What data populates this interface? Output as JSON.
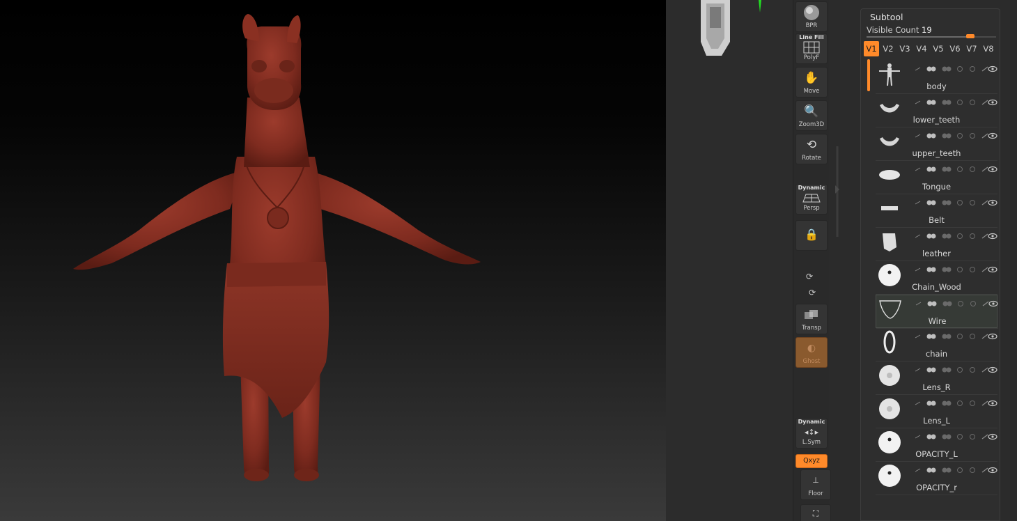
{
  "subtool": {
    "title": "Subtool",
    "visible_count_label": "Visible Count",
    "visible_count": "19",
    "visible_count_fraction": 0.8,
    "version_tabs": [
      "V1",
      "V2",
      "V3",
      "V4",
      "V5",
      "V6",
      "V7",
      "V8"
    ],
    "active_tab": "V1",
    "items": [
      {
        "name": "body",
        "icon": "body-thumb-icon"
      },
      {
        "name": "lower_teeth",
        "icon": "teeth-thumb-icon"
      },
      {
        "name": "upper_teeth",
        "icon": "teeth-thumb-icon"
      },
      {
        "name": "Tongue",
        "icon": "tongue-thumb-icon"
      },
      {
        "name": "Belt",
        "icon": "belt-thumb-icon"
      },
      {
        "name": "leather",
        "icon": "leather-thumb-icon"
      },
      {
        "name": "Chain_Wood",
        "icon": "sphere-thumb-icon"
      },
      {
        "name": "Wire",
        "icon": "wire-thumb-icon",
        "selected": true
      },
      {
        "name": "chain",
        "icon": "chain-link-thumb-icon"
      },
      {
        "name": "Lens_R",
        "icon": "lens-thumb-icon"
      },
      {
        "name": "Lens_L",
        "icon": "lens-thumb-icon"
      },
      {
        "name": "OPACITY_L",
        "icon": "sphere-thumb-icon"
      },
      {
        "name": "OPACITY_r",
        "icon": "sphere-thumb-icon"
      }
    ]
  },
  "shelf": {
    "bpr": "BPR",
    "linefill_top": "Line Fill",
    "polyf": "PolyF",
    "move": "Move",
    "zoom3d": "Zoom3D",
    "rotate": "Rotate",
    "dynamic_top": "Dynamic",
    "persp": "Persp",
    "transp": "Transp",
    "ghost": "Ghost",
    "lsym_top": "Dynamic",
    "lsym": "L.Sym",
    "xyz": "Qxyz",
    "floor": "Floor",
    "rotate_y_icon": "rotate-y-icon",
    "rotate_z_icon": "rotate-z-icon"
  },
  "colors": {
    "accent": "#ff8a2a",
    "model": "#8a2f22",
    "panel": "#2e2e2e"
  }
}
